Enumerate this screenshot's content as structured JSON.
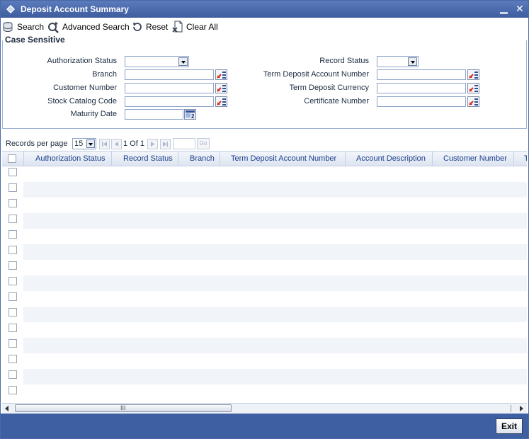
{
  "window": {
    "title": "Deposit Account Summary"
  },
  "toolbar": {
    "search": "Search",
    "advanced_search": "Advanced Search",
    "reset": "Reset",
    "clear_all": "Clear All"
  },
  "criteria": {
    "section_label": "Case Sensitive",
    "authorization_status": "Authorization Status",
    "record_status": "Record Status",
    "branch": "Branch",
    "term_deposit_account_number": "Term Deposit Account Number",
    "customer_number": "Customer Number",
    "term_deposit_currency": "Term Deposit Currency",
    "stock_catalog_code": "Stock Catalog Code",
    "certificate_number": "Certificate Number",
    "maturity_date": "Maturity Date"
  },
  "pager": {
    "records_per_page_label": "Records per page",
    "records_per_page": "15",
    "page_info": "1 Of 1",
    "go": "Go"
  },
  "grid": {
    "columns": [
      "Authorization Status",
      "Record Status",
      "Branch",
      "Term Deposit Account Number",
      "Account Description",
      "Customer Number",
      "T"
    ]
  },
  "scrollbar": {
    "grip": "III"
  },
  "footer": {
    "exit": "Exit"
  },
  "colors": {
    "title_bar": "#4a6aab",
    "footer": "#3f5fa3",
    "header_text": "#1c3f8a"
  }
}
